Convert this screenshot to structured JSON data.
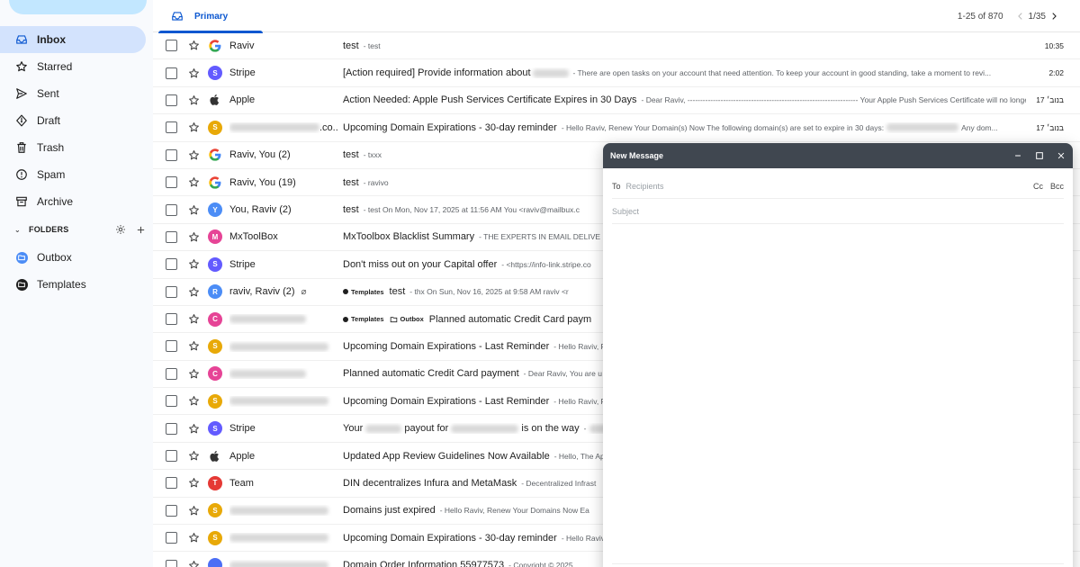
{
  "sidebar": {
    "items": [
      {
        "label": "Inbox",
        "icon": "inbox-icon",
        "active": true
      },
      {
        "label": "Starred",
        "icon": "star-icon"
      },
      {
        "label": "Sent",
        "icon": "send-icon"
      },
      {
        "label": "Draft",
        "icon": "draft-icon"
      },
      {
        "label": "Trash",
        "icon": "trash-icon"
      },
      {
        "label": "Spam",
        "icon": "spam-icon"
      },
      {
        "label": "Archive",
        "icon": "archive-icon"
      }
    ],
    "folders_header": "FOLDERS",
    "folders": [
      {
        "label": "Outbox",
        "color": "#4c8df6"
      },
      {
        "label": "Templates",
        "color": "#1f1f1f"
      }
    ]
  },
  "tabs": {
    "primary": "Primary"
  },
  "pager": {
    "range": "1-25 of 870",
    "page": "1/35"
  },
  "colors": {
    "accent": "#0b57d0",
    "active_bg": "#d3e3fd",
    "compose_header": "#404750"
  },
  "rows": [
    {
      "sender": "Raviv",
      "av": "G",
      "avtype": "google",
      "subject": "test",
      "snippet": "- test",
      "time": "10:35"
    },
    {
      "sender": "Stripe",
      "av": "S",
      "avcolor": "#635bff",
      "subject": "[Action required] Provide information about",
      "blur_after_subject": 40,
      "snippet": "- There are open tasks on your account that need attention. To keep your account in good standing, take a moment to revi...",
      "time": "2:02"
    },
    {
      "sender": "Apple",
      "av": "",
      "avtype": "apple",
      "subject": "Action Needed: Apple Push Services Certificate Expires in 30 Days",
      "snippet": "- Dear Raviv, ------------------------------------------------------------------- Your Apple Push Services Certificate will no longer ...",
      "time": "17 בנוב׳"
    },
    {
      "sender_suffix": ".co...",
      "sender_blur": 100,
      "av": "S",
      "avcolor": "#e8a908",
      "subject": "Upcoming Domain Expirations - 30-day reminder",
      "snippet": "- Hello Raviv, Renew Your Domain(s) Now The following domain(s) are set to expire in 30 days:",
      "blur_after_snippet": 80,
      "snippet2": "Any dom...",
      "time": "17 בנוב׳"
    },
    {
      "sender": "Raviv, You (2)",
      "av": "G",
      "avtype": "google",
      "subject": "test",
      "snippet": "- txxx",
      "time": ""
    },
    {
      "sender": "Raviv, You (19)",
      "av": "G",
      "avtype": "google",
      "subject": "test",
      "snippet": "- ravivo",
      "time": ""
    },
    {
      "sender": "You, Raviv (2)",
      "av": "Y",
      "avcolor": "#4c8df6",
      "subject": "test",
      "snippet": "- test On Mon, Nov 17, 2025 at 11:56 AM You <raviv@mailbux.c",
      "time": ""
    },
    {
      "sender": "MxToolBox",
      "av": "M",
      "avcolor": "#e64496",
      "subject": "MxToolbox Blacklist Summary",
      "snippet": "- THE EXPERTS IN EMAIL DELIVE",
      "time": ""
    },
    {
      "sender": "Stripe",
      "av": "S",
      "avcolor": "#635bff",
      "subject": "Don't miss out on your Capital offer",
      "snippet": "- <https://info-link.stripe.co",
      "time": ""
    },
    {
      "sender": "raviv, Raviv (2)",
      "av": "R",
      "avcolor": "#4c8df6",
      "clip": true,
      "chips": [
        {
          "label": "Templates",
          "kind": "dot"
        }
      ],
      "subject": "test",
      "snippet": "- thx On Sun, Nov 16, 2025 at 9:58 AM raviv <r",
      "time": ""
    },
    {
      "sender_blur": 85,
      "av": "C",
      "avcolor": "#e64496",
      "chips": [
        {
          "label": "Templates",
          "kind": "dot"
        },
        {
          "label": "Outbox",
          "kind": "folder"
        }
      ],
      "subject": "Planned automatic Credit Card paym",
      "snippet": "",
      "time": ""
    },
    {
      "sender_blur": 110,
      "av": "S",
      "avcolor": "#e8a908",
      "subject": "Upcoming Domain Expirations - Last Reminder",
      "snippet": "- Hello Raviv, F",
      "time": ""
    },
    {
      "sender_blur": 85,
      "av": "C",
      "avcolor": "#e64496",
      "subject": "Planned automatic Credit Card payment",
      "snippet": "- Dear Raviv, You are u",
      "time": ""
    },
    {
      "sender_blur": 110,
      "av": "S",
      "avcolor": "#e8a908",
      "subject": "Upcoming Domain Expirations - Last Reminder",
      "snippet": "- Hello Raviv, F",
      "time": ""
    },
    {
      "sender": "Stripe",
      "av": "S",
      "avcolor": "#635bff",
      "subject_parts": [
        "Your",
        "payout for",
        "is on the way"
      ],
      "snippet": "-",
      "time": ""
    },
    {
      "sender": "Apple",
      "av": "",
      "avtype": "apple",
      "subject": "Updated App Review Guidelines Now Available",
      "snippet": "- Hello, The Ap",
      "time": ""
    },
    {
      "sender": "Team",
      "av": "T",
      "avcolor": "#e53935",
      "subject": "DIN decentralizes Infura and MetaMask",
      "snippet": "- Decentralized Infrast",
      "time": ""
    },
    {
      "sender_blur": 110,
      "av": "S",
      "avcolor": "#e8a908",
      "subject": "Domains just expired",
      "snippet": "- Hello Raviv, Renew Your Domains Now Ea",
      "time": ""
    },
    {
      "sender_blur": 110,
      "av": "S",
      "avcolor": "#e8a908",
      "subject": "Upcoming Domain Expirations - 30-day reminder",
      "snippet": "- Hello Raviv",
      "time": ""
    },
    {
      "sender_blur": 110,
      "av": "",
      "avcolor": "#4c6ef5",
      "subject": "Domain Order Information 55977573",
      "snippet": "- Copyright © 2025",
      "time": ""
    }
  ],
  "compose": {
    "title": "New Message",
    "to_label": "To",
    "to_placeholder": "Recipients",
    "cc": "Cc",
    "bcc": "Bcc",
    "subject_placeholder": "Subject"
  }
}
